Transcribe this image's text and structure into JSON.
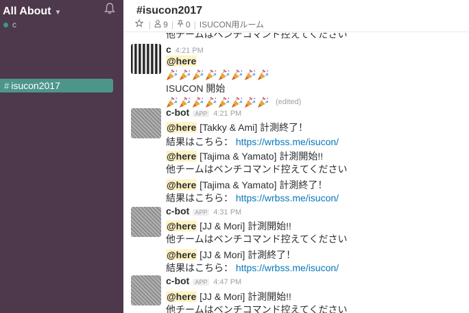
{
  "sidebar": {
    "team_name": "All About",
    "user_name": "c",
    "channels": [
      {
        "name": "isucon2017"
      }
    ]
  },
  "header": {
    "channel_title": "#isucon2017",
    "member_count": "9",
    "pinned_count": "0",
    "topic": "ISUCON用ルーム"
  },
  "clipped_text": "他チームはベンチコマンド控えてください",
  "messages": {
    "m1": {
      "sender": "c",
      "time": "4:21 PM",
      "mention": "@here",
      "line3": "ISUCON 開始",
      "edited": "(edited)"
    },
    "m2": {
      "sender": "c-bot",
      "badge": "APP",
      "time": "4:21 PM",
      "l1_mention": "@here",
      "l1_text": " [Takky & Ami] 計測終了！",
      "l2_text": "結果はこちら： ",
      "l2_link": "https://wrbss.me/isucon/",
      "l3_mention": "@here",
      "l3_text": " [Tajima & Yamato] 計測開始!!",
      "l4_text": "他チームはベンチコマンド控えてください",
      "l5_mention": "@here",
      "l5_text": " [Tajima & Yamato] 計測終了！",
      "l6_text": "結果はこちら： ",
      "l6_link": "https://wrbss.me/isucon/"
    },
    "m3": {
      "sender": "c-bot",
      "badge": "APP",
      "time": "4:31 PM",
      "l1_mention": "@here",
      "l1_text": " [JJ & Mori] 計測開始!!",
      "l2_text": "他チームはベンチコマンド控えてください",
      "l3_mention": "@here",
      "l3_text": " [JJ & Mori] 計測終了！",
      "l4_text": "結果はこちら： ",
      "l4_link": "https://wrbss.me/isucon/"
    },
    "m4": {
      "sender": "c-bot",
      "badge": "APP",
      "time": "4:47 PM",
      "l1_mention": "@here",
      "l1_text": " [JJ & Mori] 計測開始!!",
      "l2_text": "他チームはベンチコマンド控えてください"
    }
  },
  "icons": [
    "bell-icon",
    "star-icon",
    "members-icon",
    "pin-icon",
    "party-popper-icon"
  ],
  "colors": {
    "sidebar_bg": "#4d394b",
    "active_channel": "#4c9689",
    "presence": "#38978d",
    "link": "#0576b9",
    "mention_bg": "#fff3c4"
  }
}
